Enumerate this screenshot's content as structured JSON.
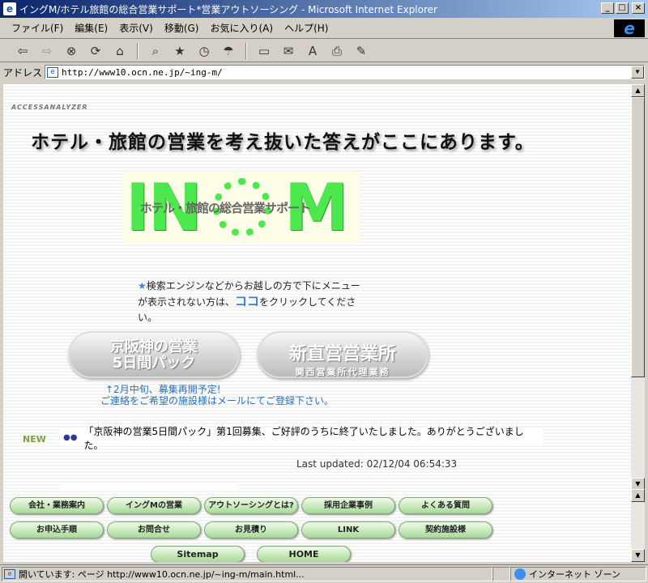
{
  "window": {
    "title": "イングM/ホテル旅館の総合営業サポート*営業アウトソーシング - Microsoft Internet Explorer"
  },
  "menu": [
    "ファイル(F)",
    "編集(E)",
    "表示(V)",
    "移動(G)",
    "お気に入り(A)",
    "ヘルプ(H)"
  ],
  "toolbar": {
    "back": "back-icon",
    "forward": "forward-icon",
    "stop": "stop-icon",
    "refresh": "refresh-icon",
    "home": "home-icon"
  },
  "address": {
    "label": "アドレス",
    "url": "http://www10.ocn.ne.jp/~ing-m/"
  },
  "page": {
    "access": "ACCESSANALYZER",
    "headline": "ホテル・旅館の営業を考え抜いた答えがここにあります。",
    "logo": {
      "left": "IN",
      "right": "M",
      "sub": "ホテル・旅館の総合営業サポート"
    },
    "notice": {
      "star": "★",
      "pre": "検索エンジンなどからお越しの方で下にメニューが表示されない方は、",
      "link": "ココ",
      "post": "をクリックしてください。"
    },
    "pill1": {
      "line1": "京阪神の営業",
      "line2": "5日間パック"
    },
    "pill2": {
      "line1": "新直営営業所",
      "line2": "関西営業所代理業務"
    },
    "recruit": {
      "line1": "↑2月中旬、募集再開予定!",
      "line2": "ご連絡をご希望の施設様はメールにてご登録下さい。"
    },
    "news": {
      "badge": "NEW",
      "dots": "●●",
      "text": "「京阪神の営業5日間パック」第1回募集、ご好評のうちに終了いたしました。ありがとうございました。"
    },
    "updated": "Last updated: 02/12/04 06:54:33",
    "nav_row1": [
      "会社・業務案内",
      "イングMの営業",
      "アウトソーシングとは?",
      "採用企業事例",
      "よくある質問"
    ],
    "nav_row2": [
      "お申込手順",
      "お問合せ",
      "お見積り",
      "LINK",
      "契約施設様"
    ],
    "nav_row3": [
      "Sitemap",
      "HOME"
    ]
  },
  "status": {
    "text": "開いています: ページ http://www10.ocn.ne.jp/~ing-m/main.html...",
    "zone": "インターネット ゾーン"
  }
}
